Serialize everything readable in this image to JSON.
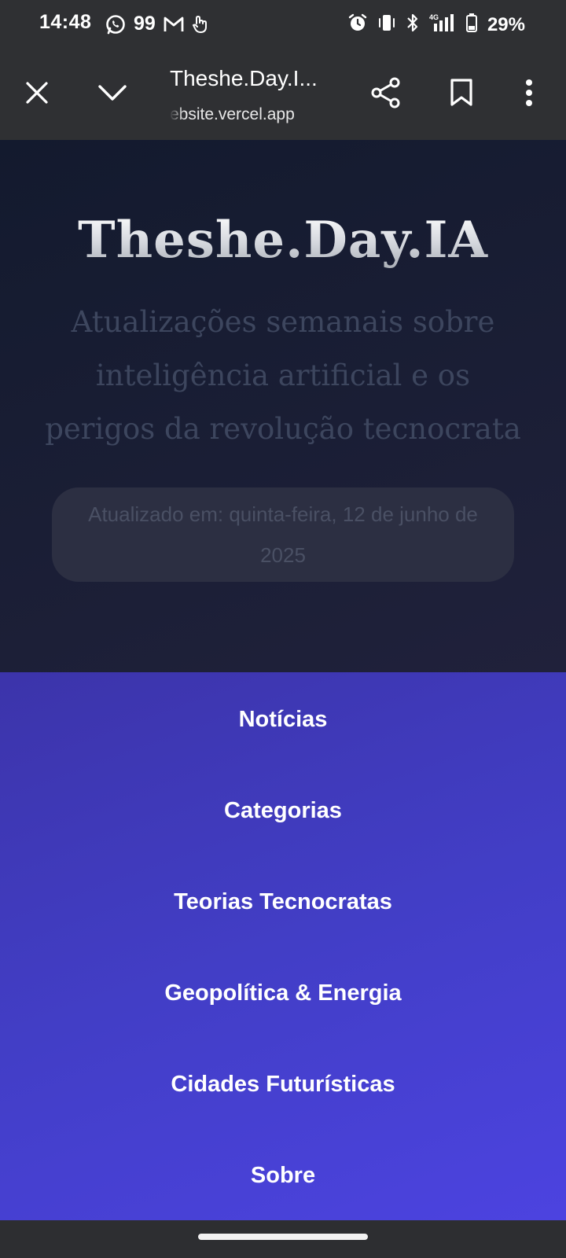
{
  "status_bar": {
    "time": "14:48",
    "notification_count": "99",
    "network": "4G",
    "battery_percent": "29%",
    "icons": [
      "whatsapp-icon",
      "gmail-icon",
      "gesture-hand-icon",
      "alarm-icon",
      "vibrate-icon",
      "bluetooth-icon",
      "signal-icon",
      "battery-icon"
    ]
  },
  "browser": {
    "tab_title": "Theshe.Day.I...",
    "url_display": "ebsite.vercel.app",
    "icons": [
      "close-icon",
      "chevron-down-icon",
      "share-icon",
      "bookmark-icon",
      "more-vert-icon"
    ]
  },
  "hero": {
    "title": "Theshe.Day.IA",
    "subtitle": "Atualizações semanais sobre inteligência artificial e os perigos da revolução tecnocrata",
    "updated_text": "Atualizado em: quinta-feira, 12 de junho de 2025"
  },
  "nav": {
    "items": [
      {
        "label": "Notícias"
      },
      {
        "label": "Categorias"
      },
      {
        "label": "Teorias Tecnocratas"
      },
      {
        "label": "Geopolítica & Energia"
      },
      {
        "label": "Cidades Futurísticas"
      },
      {
        "label": "Sobre"
      }
    ]
  },
  "colors": {
    "status_bar_bg": "#2f3033",
    "hero_bg": "#161b30",
    "nav_bg_start": "#3c34aa",
    "nav_bg_end": "#4c43e0",
    "update_box_bg": "#2c2f42"
  }
}
